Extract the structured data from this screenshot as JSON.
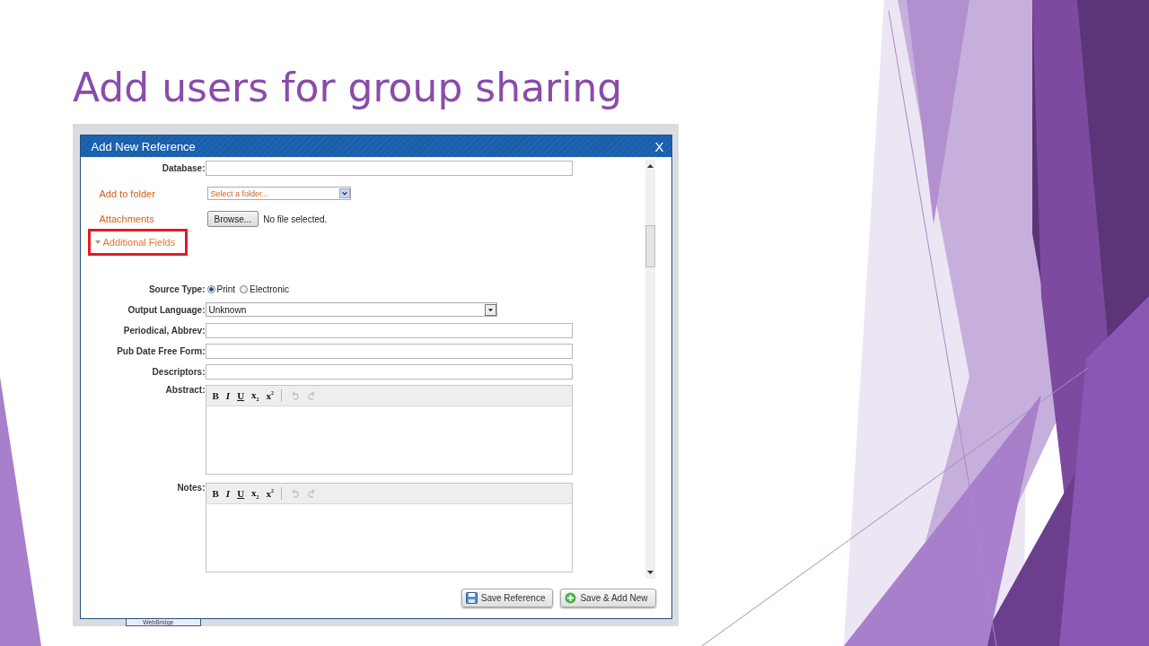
{
  "slide": {
    "title": "Add users for group sharing"
  },
  "dialog": {
    "title": "Add New Reference",
    "close": "X",
    "database": {
      "label": "Database:"
    },
    "folder": {
      "label": "Add to folder",
      "value": "Select a folder..."
    },
    "attachments": {
      "label": "Attachments",
      "button": "Browse...",
      "status": "No file selected."
    },
    "additional": {
      "label": "Additional Fields",
      "expanded": true,
      "highlighted": true
    },
    "fields": [
      {
        "kind": "radio",
        "label": "Source Type:",
        "options": [
          {
            "label": "Print",
            "selected": true
          },
          {
            "label": "Electronic",
            "selected": false
          }
        ]
      },
      {
        "kind": "select",
        "label": "Output Language:",
        "value": "Unknown"
      },
      {
        "kind": "text",
        "label": "Periodical, Abbrev:"
      },
      {
        "kind": "text",
        "label": "Pub Date Free Form:"
      },
      {
        "kind": "text",
        "label": "Descriptors:"
      },
      {
        "kind": "editor",
        "label": "Abstract:",
        "toolbar": [
          {
            "kind": "bold",
            "label": "B"
          },
          {
            "kind": "italic",
            "label": "I"
          },
          {
            "kind": "underline",
            "label": "U"
          },
          {
            "kind": "subscript",
            "label": "x$_{2}$"
          },
          {
            "kind": "superscript",
            "label": "x$^{2}$"
          },
          {
            "kind": "undo",
            "disabled": true
          },
          {
            "kind": "redo",
            "disabled": true
          }
        ]
      },
      {
        "kind": "editor",
        "label": "Notes:",
        "toolbar": [
          {
            "kind": "bold",
            "label": "B"
          },
          {
            "kind": "italic",
            "label": "I"
          },
          {
            "kind": "underline",
            "label": "U"
          },
          {
            "kind": "subscript",
            "label": "x$_{2}$"
          },
          {
            "kind": "superscript",
            "label": "x$^{2}$"
          },
          {
            "kind": "undo",
            "disabled": true
          },
          {
            "kind": "redo",
            "disabled": true
          }
        ]
      }
    ],
    "buttons": [
      {
        "kind": "save",
        "label": "Save Reference"
      },
      {
        "kind": "add",
        "label": "Save & Add New"
      }
    ]
  },
  "background_app": {
    "tab": "WebBridge"
  }
}
